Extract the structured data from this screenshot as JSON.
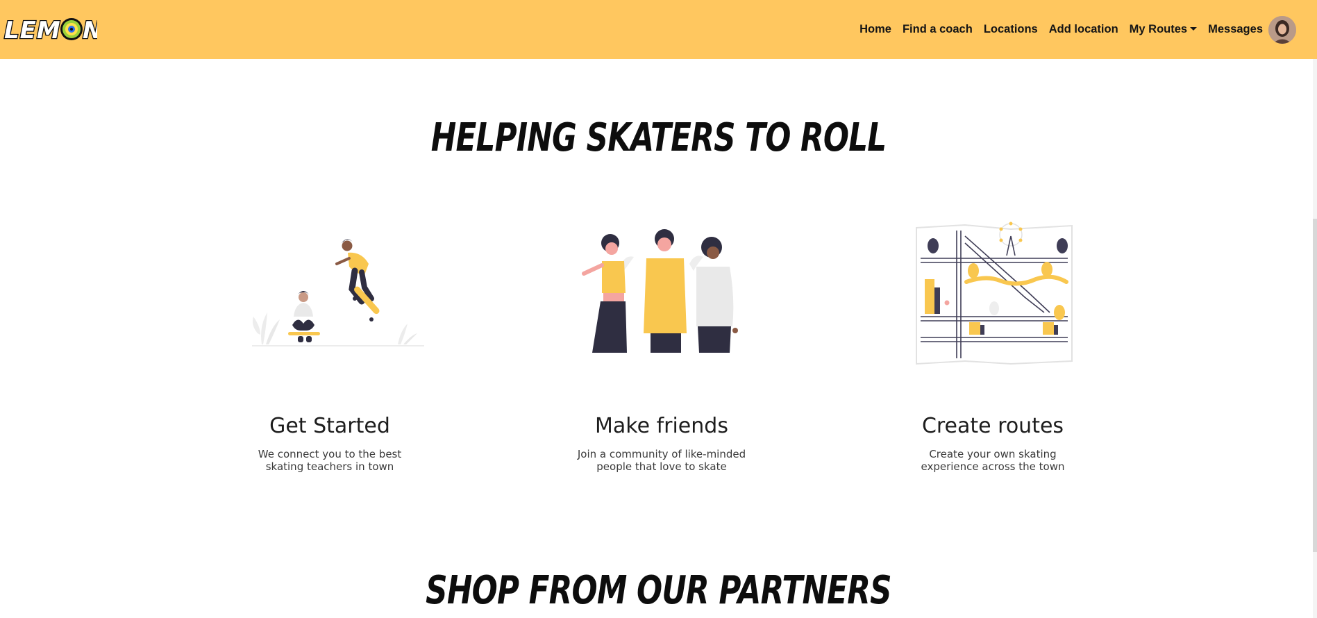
{
  "app": {
    "logo_text": "LEMON"
  },
  "nav": {
    "items": [
      {
        "label": "Home"
      },
      {
        "label": "Find a coach"
      },
      {
        "label": "Locations"
      },
      {
        "label": "Add location"
      },
      {
        "label": "My Routes"
      },
      {
        "label": "Messages"
      }
    ]
  },
  "hero": {
    "title": "HELPING SKATERS TO ROLL"
  },
  "features": [
    {
      "icon": "skaters-illustration-icon",
      "title": "Get Started",
      "description": "We connect you to the best skating teachers in town"
    },
    {
      "icon": "friends-illustration-icon",
      "title": "Make friends",
      "description": "Join a community of like-minded people that love to skate"
    },
    {
      "icon": "city-map-illustration-icon",
      "title": "Create routes",
      "description": "Create your own skating experience across the town"
    }
  ],
  "partners": {
    "title": "SHOP FROM OUR PARTNERS"
  },
  "colors": {
    "brand_yellow": "#ffc75f",
    "illustration_yellow": "#f9c74f",
    "illustration_dark": "#2f2e41",
    "text_dark": "#1b1b1b"
  }
}
